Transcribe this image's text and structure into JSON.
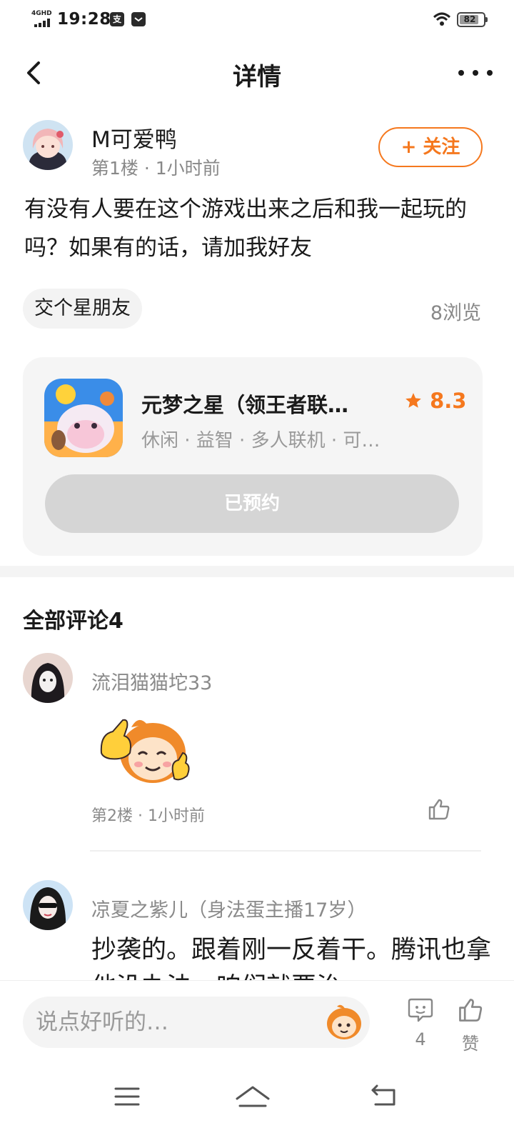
{
  "status_bar": {
    "network": "4GHD",
    "time": "19:28",
    "app_badge": "支",
    "battery": "82"
  },
  "header": {
    "title": "详情"
  },
  "post": {
    "author_name": "M可爱鸭",
    "meta": "第1楼 · 1小时前",
    "follow_label": "+ 关注",
    "text": "有没有人要在这个游戏出来之后和我一起玩的吗？如果有的话，请加我好友",
    "tag": "交个星朋友",
    "views": "8浏览"
  },
  "game_card": {
    "name": "元梦之星（领王者联…",
    "rating": "8.3",
    "tags": "休闲 · 益智 · 多人联机 · 可…",
    "reserve_label": "已预约"
  },
  "comments": {
    "title": "全部评论4",
    "items": [
      {
        "user": "流泪猫猫坨33",
        "meta": "第2楼 · 1小时前"
      },
      {
        "user": "凉夏之紫儿（身法蛋主播17岁）",
        "text": "抄袭的。跟着刚一反着干。腾讯也拿他没办法，咱们就要治"
      }
    ]
  },
  "bottom_bar": {
    "input_placeholder": "说点好听的…",
    "comment_count": "4",
    "like_label": "赞"
  },
  "colors": {
    "accent": "#f5781e",
    "text": "#1a1a1a",
    "muted": "#888888"
  }
}
